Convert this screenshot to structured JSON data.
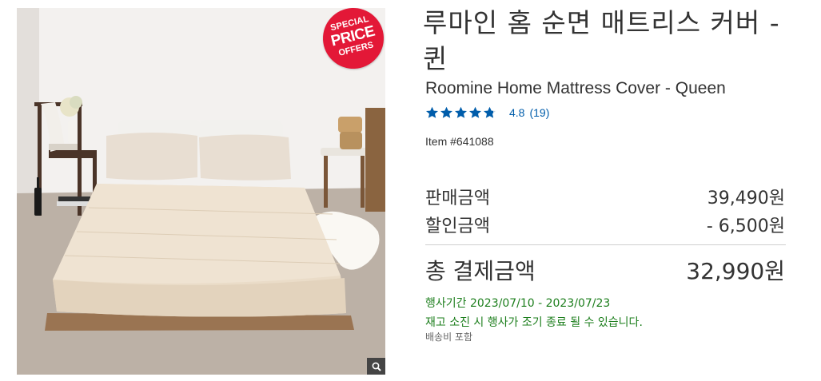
{
  "badge": {
    "line1": "SPECIAL",
    "line2": "PRICE",
    "line3": "OFFERS"
  },
  "product": {
    "title_ko": "루마인 홈 순면 매트리스 커버 - 퀸",
    "title_en": "Roomine Home Mattress Cover - Queen",
    "rating": "4.8",
    "rating_value": 4.8,
    "rating_max": 5,
    "review_count": "(19)",
    "item_number": "Item #641088"
  },
  "pricing": {
    "sale_label": "판매금액",
    "sale_value": "39,490원",
    "discount_label": "할인금액",
    "discount_value": "- 6,500원",
    "total_label": "총 결제금액",
    "total_value": "32,990원"
  },
  "promo": {
    "period": "행사기간 2023/07/10 - 2023/07/23",
    "notice": "재고 소진 시 행사가 조기 종료 될 수 있습니다.",
    "shipping": "배송비 포함"
  },
  "icons": {
    "zoom": "magnifier-icon",
    "star": "star-icon"
  },
  "colors": {
    "badge": "#e31837",
    "link": "#005dab",
    "promo": "#1e7f1e",
    "stars": "#005dab"
  }
}
